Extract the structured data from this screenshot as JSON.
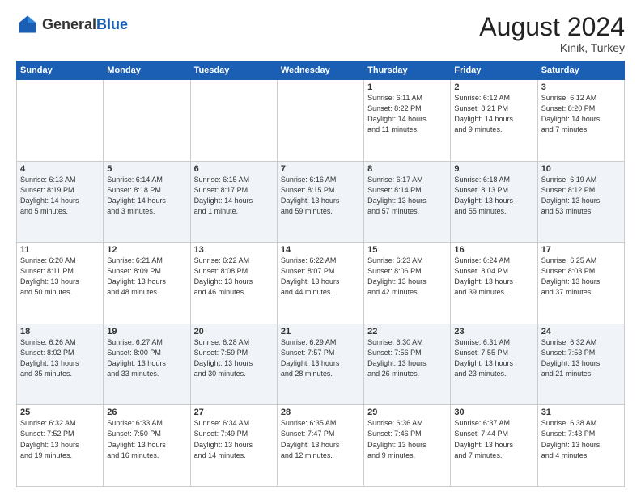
{
  "header": {
    "logo_general": "General",
    "logo_blue": "Blue",
    "month_year": "August 2024",
    "location": "Kinik, Turkey"
  },
  "weekdays": [
    "Sunday",
    "Monday",
    "Tuesday",
    "Wednesday",
    "Thursday",
    "Friday",
    "Saturday"
  ],
  "weeks": [
    [
      {
        "day": "",
        "info": ""
      },
      {
        "day": "",
        "info": ""
      },
      {
        "day": "",
        "info": ""
      },
      {
        "day": "",
        "info": ""
      },
      {
        "day": "1",
        "info": "Sunrise: 6:11 AM\nSunset: 8:22 PM\nDaylight: 14 hours\nand 11 minutes."
      },
      {
        "day": "2",
        "info": "Sunrise: 6:12 AM\nSunset: 8:21 PM\nDaylight: 14 hours\nand 9 minutes."
      },
      {
        "day": "3",
        "info": "Sunrise: 6:12 AM\nSunset: 8:20 PM\nDaylight: 14 hours\nand 7 minutes."
      }
    ],
    [
      {
        "day": "4",
        "info": "Sunrise: 6:13 AM\nSunset: 8:19 PM\nDaylight: 14 hours\nand 5 minutes."
      },
      {
        "day": "5",
        "info": "Sunrise: 6:14 AM\nSunset: 8:18 PM\nDaylight: 14 hours\nand 3 minutes."
      },
      {
        "day": "6",
        "info": "Sunrise: 6:15 AM\nSunset: 8:17 PM\nDaylight: 14 hours\nand 1 minute."
      },
      {
        "day": "7",
        "info": "Sunrise: 6:16 AM\nSunset: 8:15 PM\nDaylight: 13 hours\nand 59 minutes."
      },
      {
        "day": "8",
        "info": "Sunrise: 6:17 AM\nSunset: 8:14 PM\nDaylight: 13 hours\nand 57 minutes."
      },
      {
        "day": "9",
        "info": "Sunrise: 6:18 AM\nSunset: 8:13 PM\nDaylight: 13 hours\nand 55 minutes."
      },
      {
        "day": "10",
        "info": "Sunrise: 6:19 AM\nSunset: 8:12 PM\nDaylight: 13 hours\nand 53 minutes."
      }
    ],
    [
      {
        "day": "11",
        "info": "Sunrise: 6:20 AM\nSunset: 8:11 PM\nDaylight: 13 hours\nand 50 minutes."
      },
      {
        "day": "12",
        "info": "Sunrise: 6:21 AM\nSunset: 8:09 PM\nDaylight: 13 hours\nand 48 minutes."
      },
      {
        "day": "13",
        "info": "Sunrise: 6:22 AM\nSunset: 8:08 PM\nDaylight: 13 hours\nand 46 minutes."
      },
      {
        "day": "14",
        "info": "Sunrise: 6:22 AM\nSunset: 8:07 PM\nDaylight: 13 hours\nand 44 minutes."
      },
      {
        "day": "15",
        "info": "Sunrise: 6:23 AM\nSunset: 8:06 PM\nDaylight: 13 hours\nand 42 minutes."
      },
      {
        "day": "16",
        "info": "Sunrise: 6:24 AM\nSunset: 8:04 PM\nDaylight: 13 hours\nand 39 minutes."
      },
      {
        "day": "17",
        "info": "Sunrise: 6:25 AM\nSunset: 8:03 PM\nDaylight: 13 hours\nand 37 minutes."
      }
    ],
    [
      {
        "day": "18",
        "info": "Sunrise: 6:26 AM\nSunset: 8:02 PM\nDaylight: 13 hours\nand 35 minutes."
      },
      {
        "day": "19",
        "info": "Sunrise: 6:27 AM\nSunset: 8:00 PM\nDaylight: 13 hours\nand 33 minutes."
      },
      {
        "day": "20",
        "info": "Sunrise: 6:28 AM\nSunset: 7:59 PM\nDaylight: 13 hours\nand 30 minutes."
      },
      {
        "day": "21",
        "info": "Sunrise: 6:29 AM\nSunset: 7:57 PM\nDaylight: 13 hours\nand 28 minutes."
      },
      {
        "day": "22",
        "info": "Sunrise: 6:30 AM\nSunset: 7:56 PM\nDaylight: 13 hours\nand 26 minutes."
      },
      {
        "day": "23",
        "info": "Sunrise: 6:31 AM\nSunset: 7:55 PM\nDaylight: 13 hours\nand 23 minutes."
      },
      {
        "day": "24",
        "info": "Sunrise: 6:32 AM\nSunset: 7:53 PM\nDaylight: 13 hours\nand 21 minutes."
      }
    ],
    [
      {
        "day": "25",
        "info": "Sunrise: 6:32 AM\nSunset: 7:52 PM\nDaylight: 13 hours\nand 19 minutes."
      },
      {
        "day": "26",
        "info": "Sunrise: 6:33 AM\nSunset: 7:50 PM\nDaylight: 13 hours\nand 16 minutes."
      },
      {
        "day": "27",
        "info": "Sunrise: 6:34 AM\nSunset: 7:49 PM\nDaylight: 13 hours\nand 14 minutes."
      },
      {
        "day": "28",
        "info": "Sunrise: 6:35 AM\nSunset: 7:47 PM\nDaylight: 13 hours\nand 12 minutes."
      },
      {
        "day": "29",
        "info": "Sunrise: 6:36 AM\nSunset: 7:46 PM\nDaylight: 13 hours\nand 9 minutes."
      },
      {
        "day": "30",
        "info": "Sunrise: 6:37 AM\nSunset: 7:44 PM\nDaylight: 13 hours\nand 7 minutes."
      },
      {
        "day": "31",
        "info": "Sunrise: 6:38 AM\nSunset: 7:43 PM\nDaylight: 13 hours\nand 4 minutes."
      }
    ]
  ]
}
